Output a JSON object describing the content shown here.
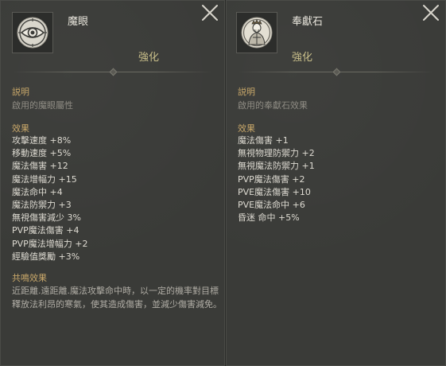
{
  "left": {
    "title": "魔眼",
    "subtitle": "強化",
    "icon": "demon-eye-icon",
    "desc_head": "説明",
    "desc": "啟用的魔眼屬性",
    "effects_head": "效果",
    "effects": [
      "攻擊速度 +8%",
      "移動速度 +5%",
      "魔法傷害 +12",
      "魔法增幅力 +15",
      "魔法命中 +4",
      "魔法防禦力 +3",
      "無視傷害減少 3%",
      "PVP魔法傷害 +4",
      "PVP魔法增幅力 +2",
      "經驗值獎勵 +3%"
    ],
    "resonance_head": "共鳴效果",
    "resonance": "近距離.遠距離.魔法攻擊命中時，以一定的機率對目標釋放法利昂的寒氣，使其造成傷害，並減少傷害減免。"
  },
  "right": {
    "title": "奉獻石",
    "subtitle": "強化",
    "icon": "priest-figure-icon",
    "desc_head": "説明",
    "desc": "啟用的奉獻石效果",
    "effects_head": "效果",
    "effects": [
      "魔法傷害 +1",
      "無視物理防禦力 +2",
      "無視魔法防禦力 +1",
      "PVP魔法傷害 +2",
      "PVE魔法傷害 +10",
      "PVE魔法命中 +6",
      "昏迷 命中 +5%"
    ]
  },
  "colors": {
    "accent_gold": "#c9a86a",
    "subtitle": "#c9bf8a",
    "text": "#dedbd2",
    "muted": "#8f8c84"
  }
}
